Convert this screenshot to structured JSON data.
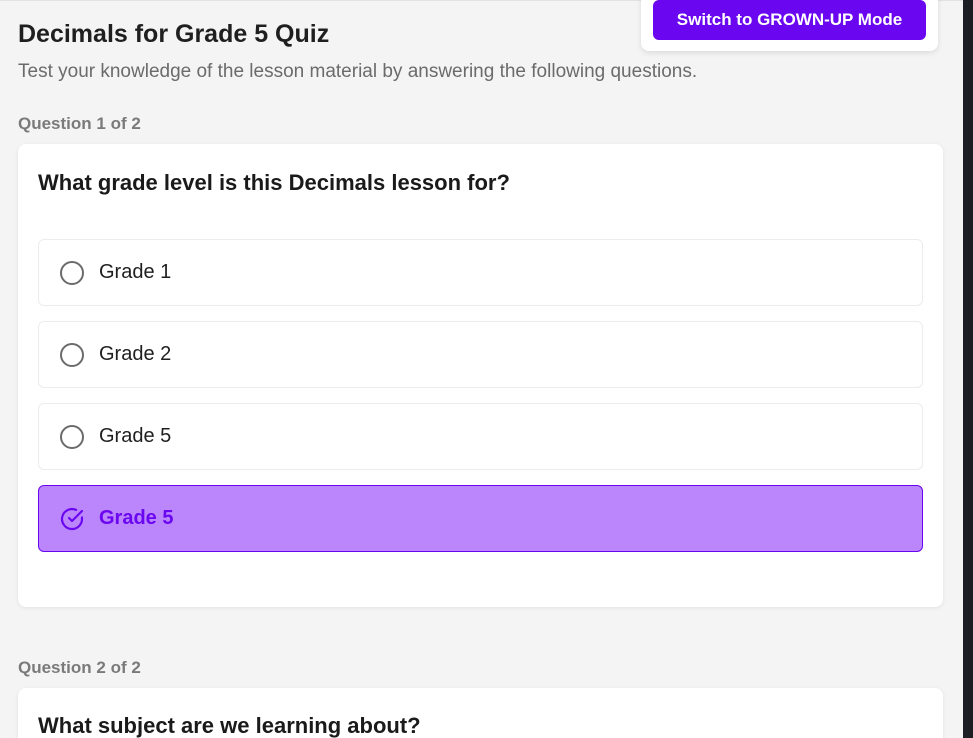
{
  "header": {
    "mode_button_label": "Switch to GROWN-UP Mode",
    "title": "Decimals for Grade 5 Quiz",
    "subtitle": "Test your knowledge of the lesson material by answering the following questions."
  },
  "questions": [
    {
      "counter": "Question 1 of 2",
      "text": "What grade level is this Decimals lesson for?",
      "options": [
        {
          "label": "Grade 1",
          "selected": false
        },
        {
          "label": "Grade 2",
          "selected": false
        },
        {
          "label": "Grade 5",
          "selected": false
        },
        {
          "label": "Grade 5",
          "selected": true
        }
      ]
    },
    {
      "counter": "Question 2 of 2",
      "text": "What subject are we learning about?"
    }
  ],
  "icons": {
    "unselected": "radio-circle-icon",
    "selected": "check-circle-icon"
  },
  "colors": {
    "accent": "#6a07f0",
    "selected_fill": "#bb86fc",
    "background": "#f4f4f4",
    "rail": "#1e1f24"
  }
}
